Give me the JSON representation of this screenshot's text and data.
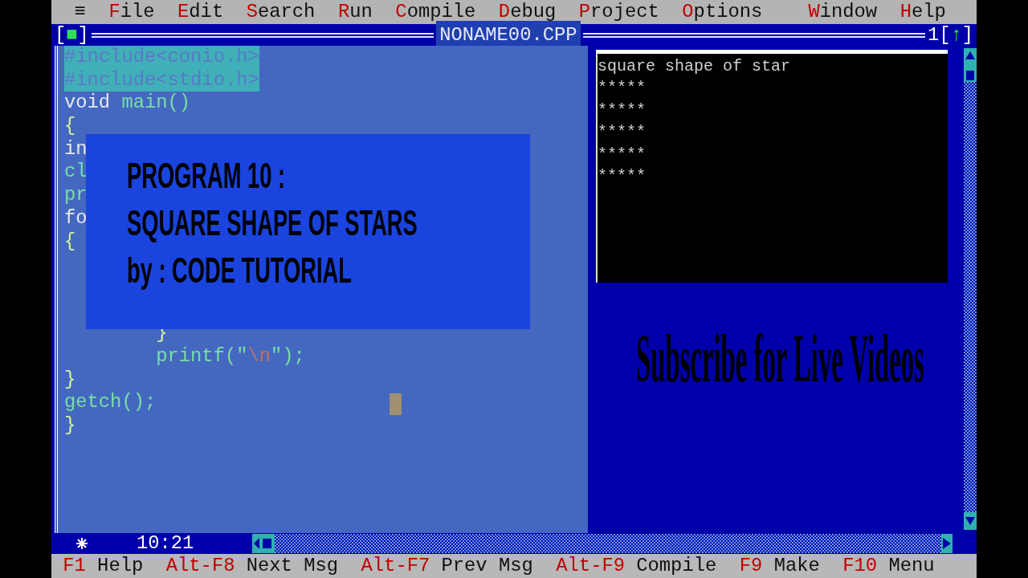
{
  "menu_icon": "≡",
  "menu": [
    {
      "hotkey": "F",
      "rest": "ile"
    },
    {
      "hotkey": "E",
      "rest": "dit"
    },
    {
      "hotkey": "S",
      "rest": "earch"
    },
    {
      "hotkey": "R",
      "rest": "un"
    },
    {
      "hotkey": "C",
      "rest": "ompile"
    },
    {
      "hotkey": "D",
      "rest": "ebug"
    },
    {
      "hotkey": "P",
      "rest": "roject"
    },
    {
      "hotkey": "O",
      "rest": "ptions"
    }
  ],
  "menu_right": [
    {
      "hotkey": "W",
      "rest": "indow"
    },
    {
      "hotkey": "H",
      "rest": "elp"
    }
  ],
  "editor": {
    "close_box": [
      "[",
      "■",
      "]"
    ],
    "title": "NONAME00.CPP",
    "window_number": "1",
    "zoom_box": [
      "[",
      "↑",
      "]"
    ],
    "lines_above": [
      {
        "highlighted": true,
        "segments": [
          {
            "text": "#include<conio.h>",
            "kind": "directive"
          }
        ]
      },
      {
        "highlighted": true,
        "segments": [
          {
            "text": "#include<stdio.h>",
            "kind": "directive"
          }
        ]
      },
      {
        "highlighted": false,
        "segments": [
          {
            "text": "void ",
            "kind": "plain"
          },
          {
            "text": "main()",
            "kind": "func"
          }
        ]
      },
      {
        "highlighted": false,
        "segments": [
          {
            "text": "{",
            "kind": "brace"
          }
        ]
      },
      {
        "highlighted": false,
        "segments": [
          {
            "text": "in",
            "kind": "plain"
          }
        ]
      },
      {
        "highlighted": false,
        "segments": [
          {
            "text": "cl",
            "kind": "func"
          }
        ]
      },
      {
        "highlighted": false,
        "segments": [
          {
            "text": "pr",
            "kind": "func"
          }
        ]
      },
      {
        "highlighted": false,
        "segments": [
          {
            "text": "fo",
            "kind": "plain"
          }
        ]
      },
      {
        "highlighted": false,
        "segments": [
          {
            "text": "{",
            "kind": "brace"
          }
        ]
      }
    ],
    "lines_below": [
      {
        "highlighted": false,
        "segments": [
          {
            "text": "        }",
            "kind": "brace"
          }
        ]
      },
      {
        "highlighted": false,
        "segments": [
          {
            "text": "        printf(\"",
            "kind": "func"
          },
          {
            "text": "\\n",
            "kind": "string"
          },
          {
            "text": "\");",
            "kind": "func"
          }
        ]
      },
      {
        "highlighted": false,
        "segments": [
          {
            "text": "}",
            "kind": "brace"
          }
        ]
      },
      {
        "highlighted": false,
        "segments": [
          {
            "text": "getch();",
            "kind": "func"
          }
        ]
      },
      {
        "highlighted": false,
        "segments": [
          {
            "text": "}",
            "kind": "brace"
          }
        ]
      }
    ],
    "position": "10:21"
  },
  "output": {
    "lines": [
      "square shape of star",
      "*****",
      "*****",
      "*****",
      "*****",
      "*****"
    ]
  },
  "banner": {
    "lines": [
      "PROGRAM 10 :",
      "SQUARE SHAPE OF STARS",
      "by : CODE TUTORIAL"
    ]
  },
  "subscribe": "Subscribe for Live Videos",
  "status_bar": [
    {
      "key": "F1",
      "label": "Help"
    },
    {
      "key": "Alt-F8",
      "label": "Next Msg"
    },
    {
      "key": "Alt-F7",
      "label": "Prev Msg"
    },
    {
      "key": "Alt-F9",
      "label": "Compile"
    },
    {
      "key": "F9",
      "label": "Make"
    },
    {
      "key": "F10",
      "label": "Menu"
    }
  ]
}
